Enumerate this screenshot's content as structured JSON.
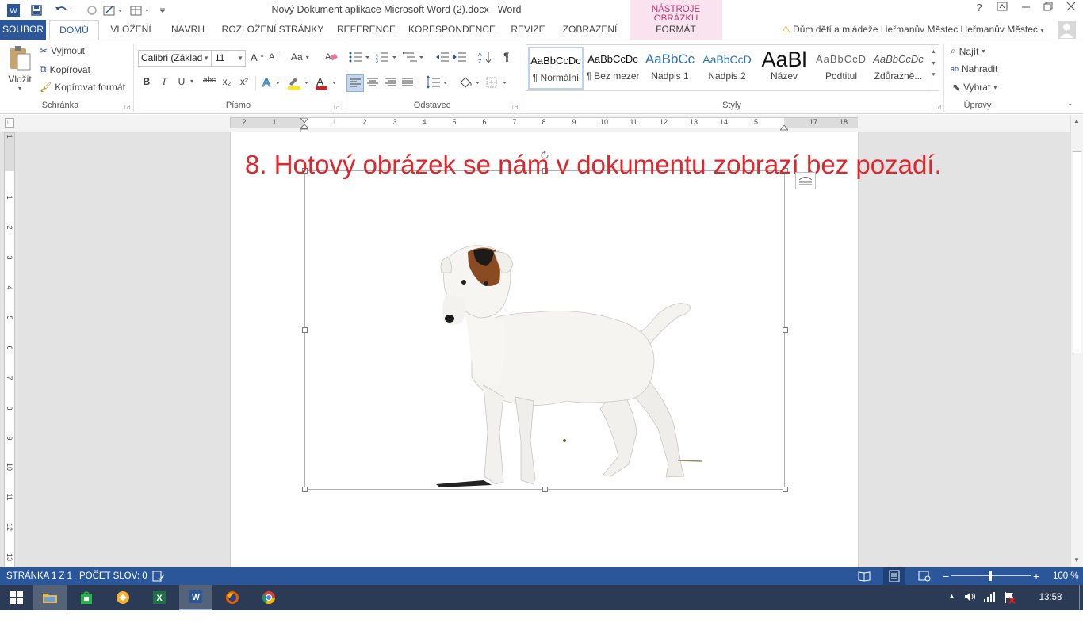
{
  "app": {
    "title": "Nový Dokument aplikace Microsoft Word (2).docx - Word",
    "context_tab_header": "NÁSTROJE OBRÁZKU",
    "help": "?",
    "account": "Dům dětí a mládeže Heřmanův Městec Heřmanův Městec"
  },
  "tabs": {
    "file": "SOUBOR",
    "home": "DOMŮ",
    "insert": "VLOŽENÍ",
    "design": "NÁVRH",
    "layout": "ROZLOŽENÍ STRÁNKY",
    "references": "REFERENCE",
    "mailings": "KORESPONDENCE",
    "review": "REVIZE",
    "view": "ZOBRAZENÍ",
    "format": "FORMÁT"
  },
  "clipboard": {
    "paste": "Vložit",
    "cut": "Vyjmout",
    "copy": "Kopírovat",
    "format_painter": "Kopírovat formát",
    "label": "Schránka"
  },
  "font": {
    "name": "Calibri (Základ",
    "size": "11",
    "case": "Aa",
    "bold": "B",
    "italic": "I",
    "underline": "U",
    "strike": "abc",
    "sub": "x₂",
    "sup": "x²",
    "label": "Písmo"
  },
  "paragraph": {
    "label": "Odstavec",
    "pilcrow": "¶"
  },
  "styles": {
    "items": [
      {
        "preview": "AaBbCcDc",
        "name": "¶ Normální"
      },
      {
        "preview": "AaBbCcDc",
        "name": "¶ Bez mezer"
      },
      {
        "preview": "AaBbCc",
        "name": "Nadpis 1"
      },
      {
        "preview": "AaBbCcD",
        "name": "Nadpis 2"
      },
      {
        "preview": "AaBl",
        "name": "Název"
      },
      {
        "preview": "AaBbCcD",
        "name": "Podtitul"
      },
      {
        "preview": "AaBbCcDc",
        "name": "Zdůrazně..."
      }
    ],
    "label": "Styly"
  },
  "editing": {
    "find": "Najít",
    "replace": "Nahradit",
    "select": "Vybrat",
    "label": "Úpravy"
  },
  "ruler": {
    "h_numbers": [
      "2",
      "1",
      "1",
      "2",
      "3",
      "4",
      "5",
      "6",
      "7",
      "8",
      "9",
      "10",
      "11",
      "12",
      "13",
      "14",
      "15",
      "17",
      "18"
    ],
    "v_numbers": [
      "1",
      "1",
      "2",
      "3",
      "4",
      "5",
      "6",
      "7",
      "8",
      "9",
      "10",
      "11",
      "12",
      "13"
    ]
  },
  "document": {
    "heading": "8. Hotový obrázek se nám v dokumentu zobrazí bez pozadí."
  },
  "status": {
    "page": "STRÁNKA 1 Z 1",
    "words": "POČET SLOV: 0",
    "zoom": "100 %"
  },
  "taskbar": {
    "clock": "13:58"
  },
  "colors": {
    "accent": "#2b579a",
    "heading": "#e0262b",
    "context_tab": "#f8e3ee",
    "taskbar": "#2b3a55"
  }
}
